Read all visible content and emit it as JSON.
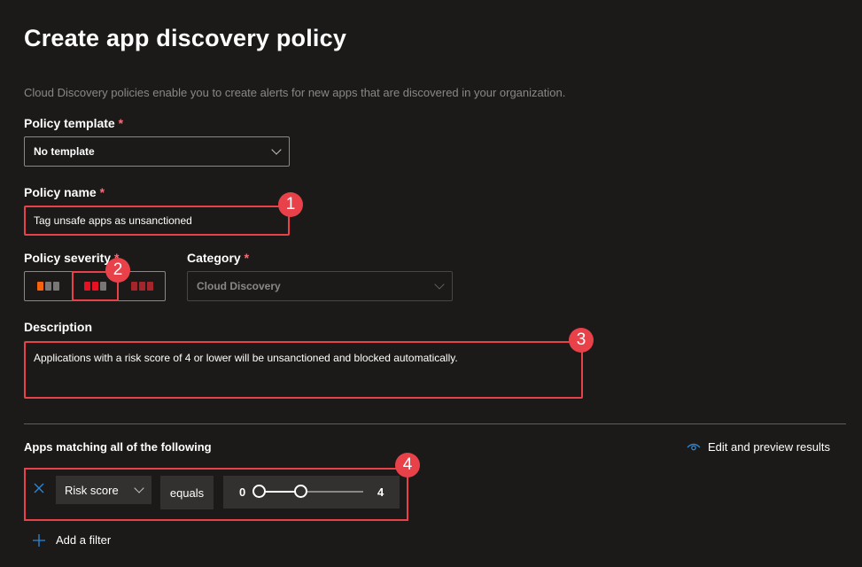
{
  "page": {
    "title": "Create app discovery policy",
    "intro": "Cloud Discovery policies enable you to create alerts for new apps that are discovered in your organization."
  },
  "policy_template": {
    "label": "Policy template",
    "required": "*",
    "value": "No template"
  },
  "policy_name": {
    "label": "Policy name",
    "required": "*",
    "value": "Tag unsafe apps as unsanctioned"
  },
  "policy_severity": {
    "label": "Policy severity",
    "required": "*",
    "options": [
      {
        "level": "low",
        "colors": [
          "#f7630c",
          "#797775",
          "#797775"
        ]
      },
      {
        "level": "medium",
        "colors": [
          "#e81123",
          "#e81123",
          "#797775"
        ],
        "selected": true
      },
      {
        "level": "high",
        "colors": [
          "#a4262c",
          "#a4262c",
          "#a4262c"
        ]
      }
    ]
  },
  "category": {
    "label": "Category",
    "required": "*",
    "value": "Cloud Discovery"
  },
  "description": {
    "label": "Description",
    "value": "Applications with a risk score of 4 or lower will be unsanctioned and blocked automatically."
  },
  "filters": {
    "heading": "Apps matching all of the following",
    "edit_preview": "Edit and preview results",
    "rows": [
      {
        "field": "Risk score",
        "operator": "equals",
        "min": "0",
        "max": "4",
        "range_from": 0,
        "range_to": 4,
        "scale_max": 10
      }
    ],
    "add_filter": "Add a filter"
  },
  "annotations": [
    "1",
    "2",
    "3",
    "4"
  ],
  "colors": {
    "accent": "#0078d4",
    "highlight": "#e8414a",
    "background": "#1b1a19"
  }
}
